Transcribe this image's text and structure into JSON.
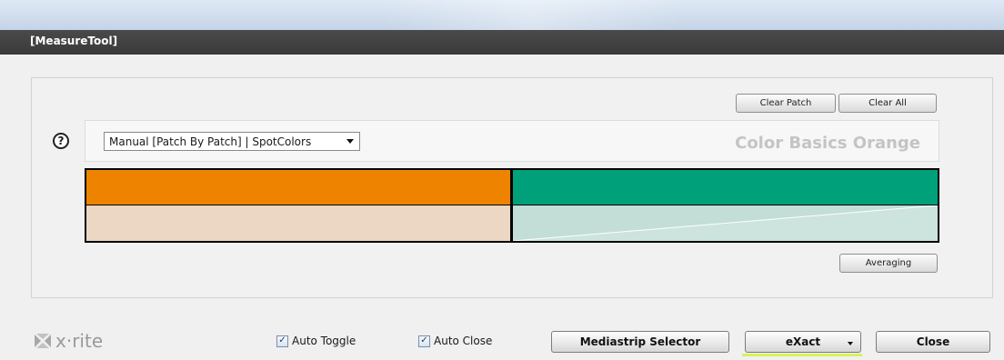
{
  "window": {
    "title": "[MeasureTool]"
  },
  "toolbar": {
    "clear_patch_label": "Clear Patch",
    "clear_all_label": "Clear All",
    "averaging_label": "Averaging"
  },
  "measure": {
    "help_label": "?",
    "mode_select_value": "Manual [Patch By Patch] | SpotColors",
    "color_name": "Color Basics Orange"
  },
  "swatches": {
    "reference_top_color": "#ee8300",
    "reference_bottom_color": "#ebd7c4",
    "measured_top_color": "#00a07a",
    "measured_bottom_color": "#c3ddd7"
  },
  "footer": {
    "logo_text": "x·rite",
    "auto_toggle": {
      "label": "Auto Toggle",
      "checked": true
    },
    "auto_close": {
      "label": "Auto Close",
      "checked": true
    },
    "mediastrip_label": "Mediastrip Selector",
    "device_label": "eXact",
    "close_label": "Close"
  },
  "icons": [
    "help-icon",
    "dropdown-arrow-icon",
    "xrite-logo-icon",
    "checkbox-checked-icon"
  ]
}
